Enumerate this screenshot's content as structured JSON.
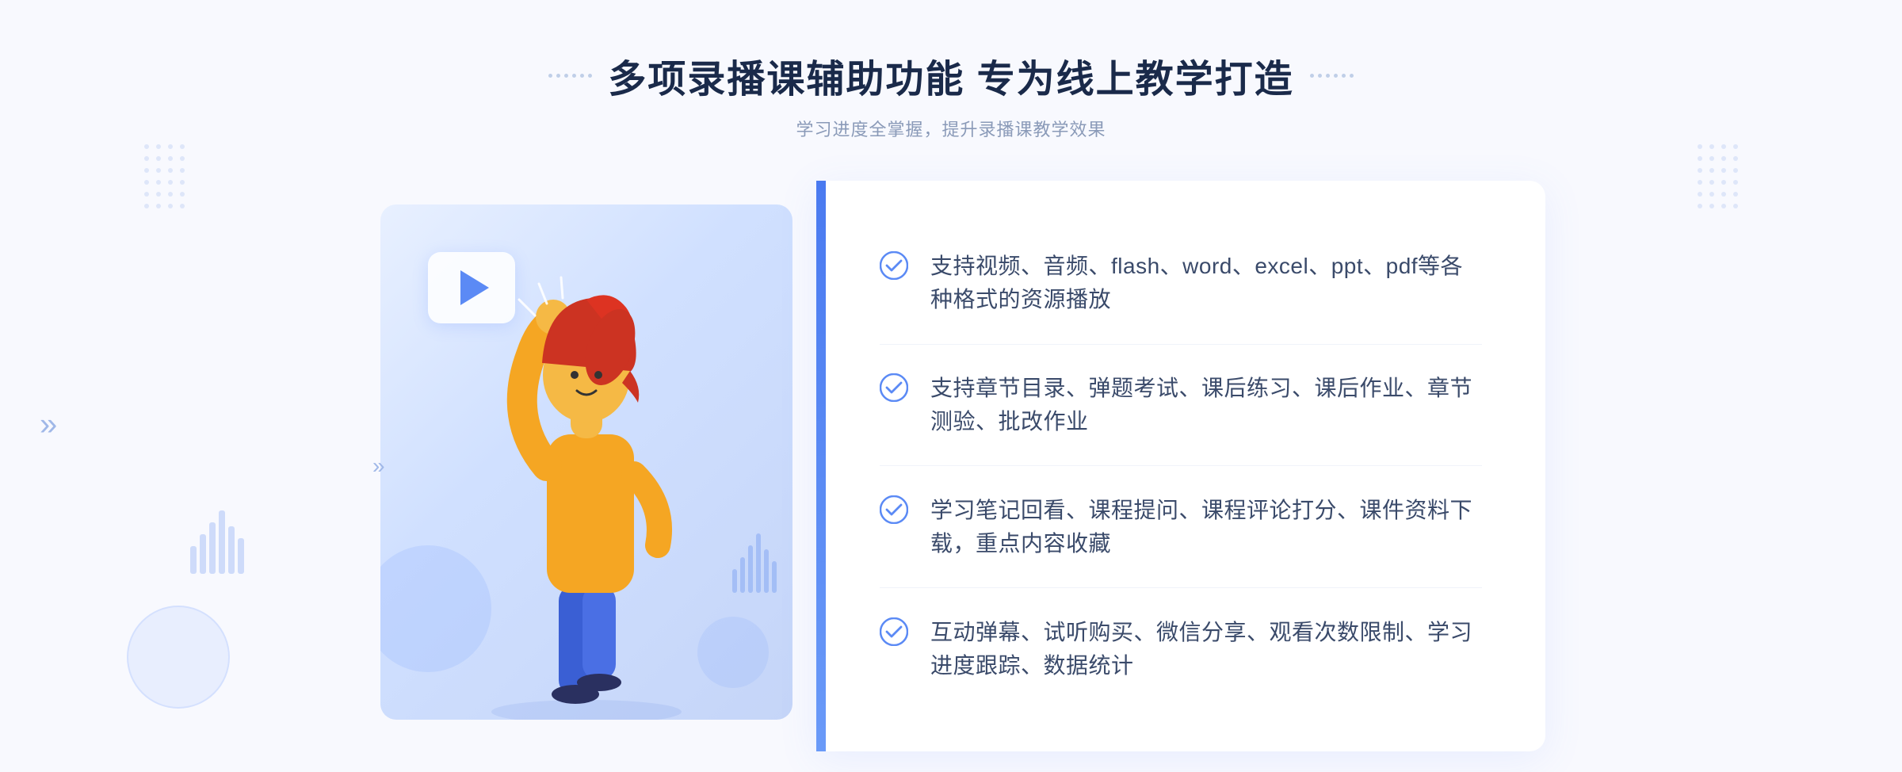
{
  "page": {
    "background_color": "#f5f7fe"
  },
  "header": {
    "title": "多项录播课辅助功能 专为线上教学打造",
    "subtitle": "学习进度全掌握，提升录播课教学效果",
    "dots_decoration": "····"
  },
  "features": [
    {
      "id": 1,
      "text": "支持视频、音频、flash、word、excel、ppt、pdf等各种格式的资源播放"
    },
    {
      "id": 2,
      "text": "支持章节目录、弹题考试、课后练习、课后作业、章节测验、批改作业"
    },
    {
      "id": 3,
      "text": "学习笔记回看、课程提问、课程评论打分、课件资料下载，重点内容收藏"
    },
    {
      "id": 4,
      "text": "互动弹幕、试听购买、微信分享、观看次数限制、学习进度跟踪、数据统计"
    }
  ],
  "illustration": {
    "play_button_visible": true,
    "accent_color": "#4a7af0",
    "bg_gradient_start": "#e0eaff",
    "bg_gradient_end": "#c8d8f8"
  },
  "icons": {
    "check_circle": "✓",
    "play": "▶",
    "chevron_right": "»",
    "chevron_right_single": "›"
  }
}
